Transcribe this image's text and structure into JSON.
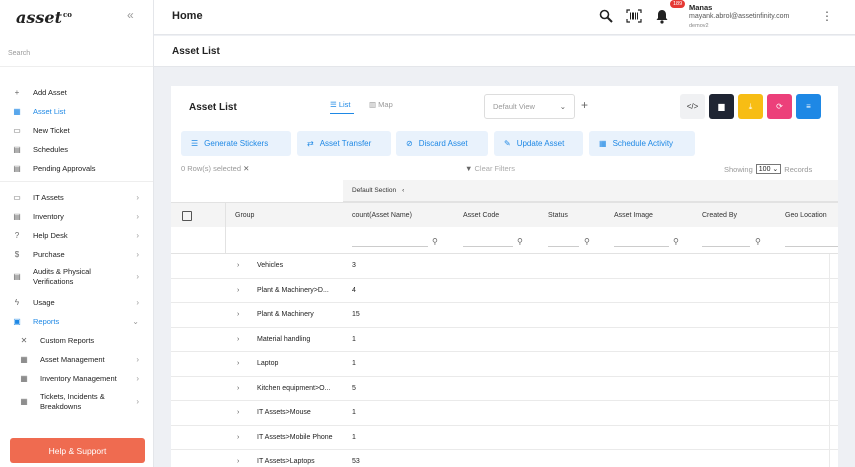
{
  "sidebar": {
    "logo": "asset",
    "logo_sup": "co",
    "collapse_icon": "«",
    "search_placeholder": "Search",
    "items": [
      {
        "label": "Add Asset",
        "icon": "+"
      },
      {
        "label": "Asset List",
        "icon": "▦"
      },
      {
        "label": "New Ticket",
        "icon": "▭"
      },
      {
        "label": "Schedules",
        "icon": "▤"
      },
      {
        "label": "Pending Approvals",
        "icon": "▤"
      },
      {
        "label": "IT Assets",
        "icon": "▭"
      },
      {
        "label": "Inventory",
        "icon": "▤"
      },
      {
        "label": "Help Desk",
        "icon": "?"
      },
      {
        "label": "Purchase",
        "icon": "$"
      },
      {
        "label": "Audits & Physical Verifications",
        "icon": "▤"
      },
      {
        "label": "Usage",
        "icon": "ϟ"
      },
      {
        "label": "Reports",
        "icon": "▣"
      },
      {
        "label": "Custom Reports",
        "icon": "✕"
      },
      {
        "label": "Asset Management",
        "icon": "▦"
      },
      {
        "label": "Inventory Management",
        "icon": "▦"
      },
      {
        "label": "Tickets, Incidents & Breakdowns",
        "icon": "▦"
      }
    ],
    "help_label": "Help & Support"
  },
  "header": {
    "title": "Home",
    "notification_count": "189",
    "user_name": "Manas",
    "user_email": "mayank.abrol@assetinfinity.com",
    "user_org": "demov2"
  },
  "page": {
    "title": "Asset List"
  },
  "card": {
    "title": "Asset List",
    "tab_list": "List",
    "tab_map": "Map",
    "view_select": "Default View",
    "actions": [
      {
        "label": "Generate Stickers",
        "icon": "☰"
      },
      {
        "label": "Asset Transfer",
        "icon": "⇄"
      },
      {
        "label": "Discard Asset",
        "icon": "⊘"
      },
      {
        "label": "Update Asset",
        "icon": "✎"
      },
      {
        "label": "Schedule Activity",
        "icon": "▦"
      }
    ],
    "rows_selected": "0 Row(s) selected",
    "clear_filters": "Clear Filters",
    "showing_label": "Showing",
    "page_size": "100",
    "records_label": "Records"
  },
  "colors": {
    "accent": "#1e88e5",
    "dark_btn": "#1f2533",
    "yellow_btn": "#f7bd14",
    "pink_btn": "#ec407a",
    "blue_btn": "#1e88e5",
    "help_btn": "#ef6b50"
  },
  "grid": {
    "section_label": "Default Section",
    "columns": [
      "Group",
      "count(Asset Name)",
      "Asset Code",
      "Status",
      "Asset Image",
      "Created By",
      "Geo Location"
    ],
    "rows": [
      {
        "group": "Vehicles",
        "count": "3"
      },
      {
        "group": "Plant & Machinery>D...",
        "count": "4"
      },
      {
        "group": "Plant & Machinery",
        "count": "15"
      },
      {
        "group": "Material handling",
        "count": "1"
      },
      {
        "group": "Laptop",
        "count": "1"
      },
      {
        "group": "Kitchen equipment>O...",
        "count": "5"
      },
      {
        "group": "IT Assets>Mouse",
        "count": "1"
      },
      {
        "group": "IT Assets>Mobile Phone",
        "count": "1"
      },
      {
        "group": "IT Assets>Laptops",
        "count": "53"
      }
    ]
  }
}
